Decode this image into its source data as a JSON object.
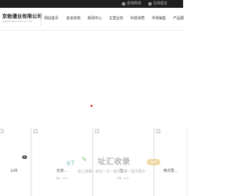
{
  "topbar": {
    "items": [
      {
        "icon": "phone-icon",
        "label": "咨询热线"
      },
      {
        "icon": "wechat-icon",
        "label": "在线留言"
      }
    ]
  },
  "header": {
    "company_name": "京勃漫业有限公司",
    "company_sub": "JIUBING INDUSTRY CO.,LTD",
    "nav": [
      "网站首页",
      "走进京勃",
      "新闻中心",
      "主营业务",
      "科技资质",
      "市场销售",
      "产品展"
    ]
  },
  "cards": [
    {
      "title": "山林",
      "badge": "4",
      "meta": ""
    },
    {
      "title": "杜鹃…",
      "badge": "",
      "meta": "查看 · 2020-"
    },
    {
      "title": "兰…",
      "badge": "",
      "meta": "查看 · 2020-"
    },
    {
      "title": "韩式君…",
      "badge": "",
      "meta": ""
    }
  ],
  "watermark": {
    "domain": "97",
    "title": "址汇收录",
    "pill": "加好",
    "slogan": "提上链接—来访一次—首页收录—首页展示"
  },
  "colors": {
    "topbar": "#1f1f1f",
    "loader": "#e0382e",
    "accent_watermark": "#e1aa3c"
  }
}
